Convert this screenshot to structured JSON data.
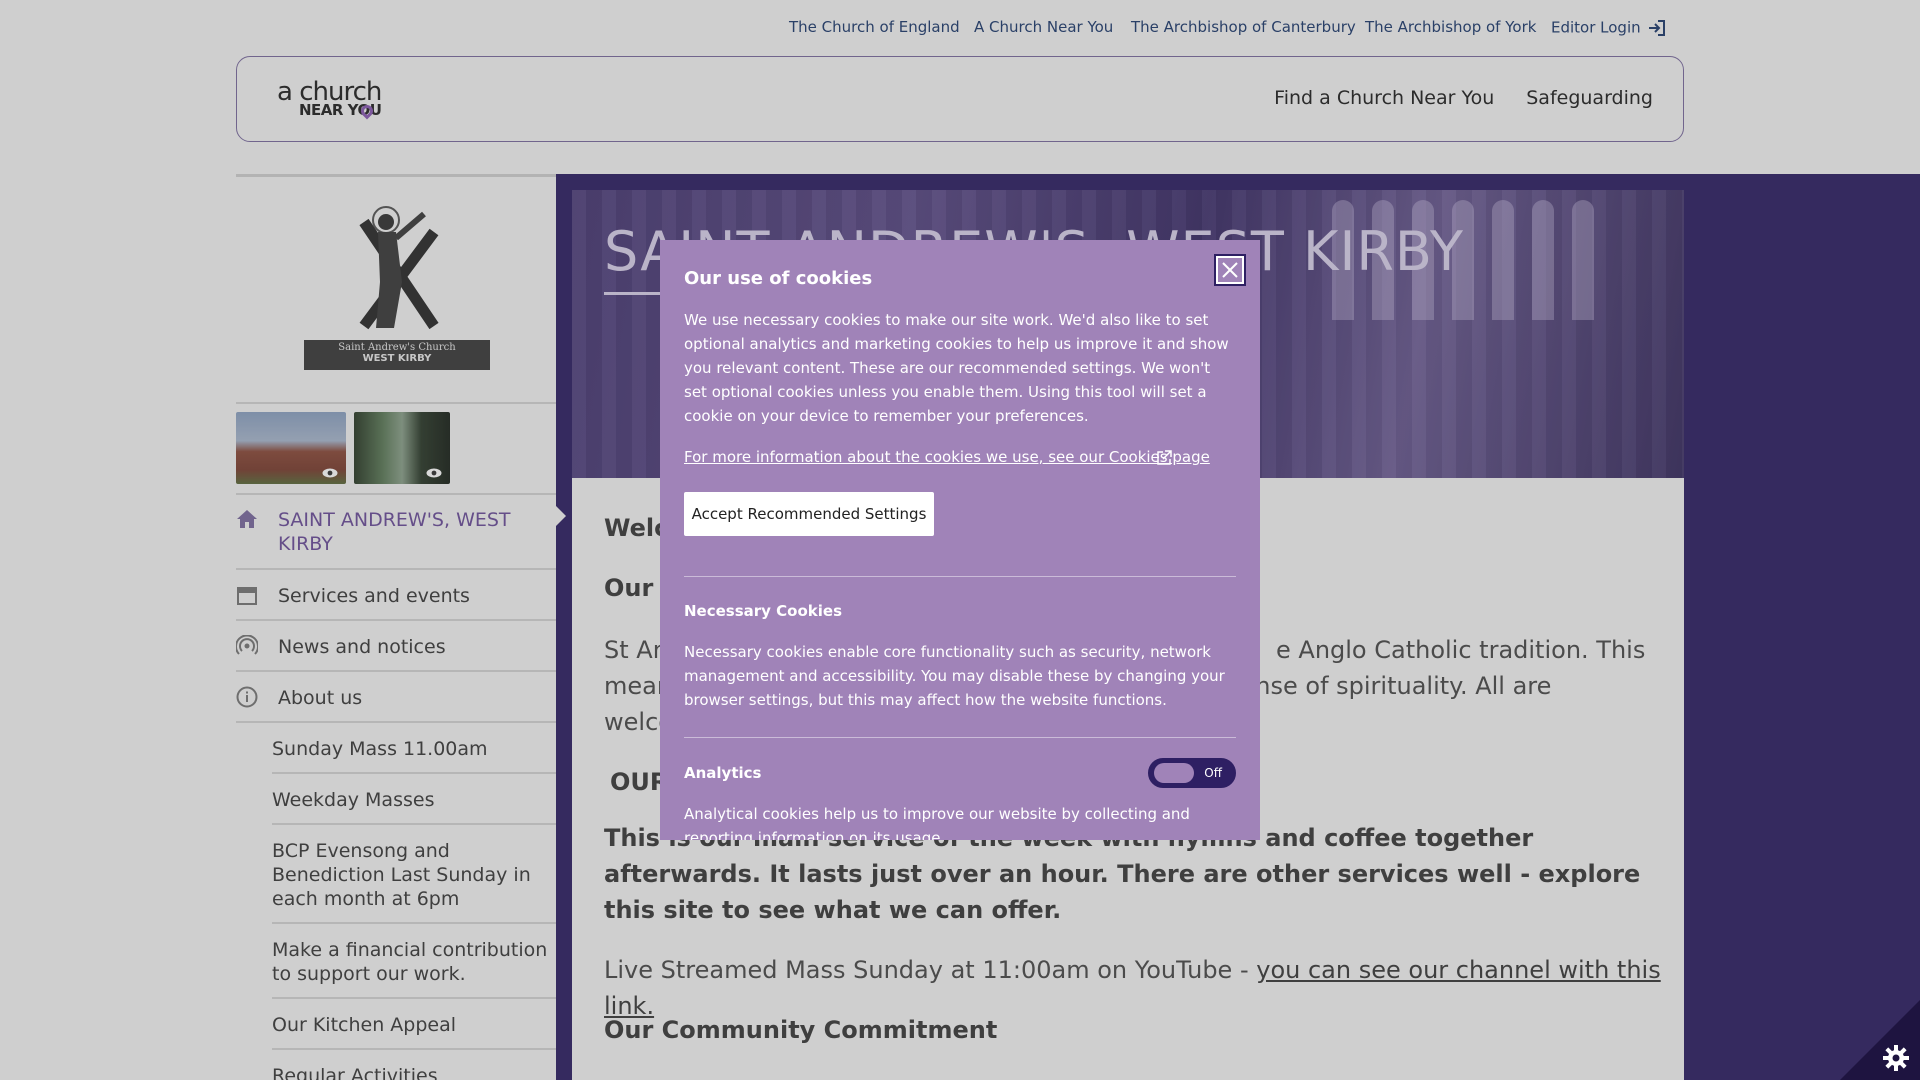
{
  "utility_nav": [
    {
      "label": "The Church of England"
    },
    {
      "label": "A Church Near You"
    },
    {
      "label": "The Archbishop of Canterbury"
    },
    {
      "label": "The Archbishop of York"
    },
    {
      "label": "Editor Login"
    }
  ],
  "logo": {
    "line1": "a church",
    "line2": "NEAR YOU"
  },
  "main_nav": [
    {
      "label": "Find a Church Near You"
    },
    {
      "label": "Safeguarding"
    }
  ],
  "crest": {
    "line1": "Saint Andrew's Church",
    "line2": "WEST KIRBY"
  },
  "sidebar": {
    "items": [
      {
        "label": "SAINT ANDREW'S, WEST KIRBY",
        "icon": "home-icon",
        "active": true
      },
      {
        "label": "Services and events",
        "icon": "calendar-icon"
      },
      {
        "label": "News and notices",
        "icon": "broadcast-icon"
      },
      {
        "label": "About us",
        "icon": "info-icon"
      }
    ],
    "subitems": [
      {
        "label": "Sunday Mass 11.00am"
      },
      {
        "label": "Weekday Masses"
      },
      {
        "label": "BCP Evensong and Benediction Last Sunday in each month at 6pm"
      },
      {
        "label": "Make a financial contribution to support our work."
      },
      {
        "label": "Our Kitchen Appeal"
      },
      {
        "label": "Regular Activities"
      }
    ]
  },
  "hero": {
    "title": "SAINT ANDREW'S, WEST KIRBY"
  },
  "content": {
    "welcome_partial": "Welc",
    "our_partial": "Our S",
    "para1_line1_left": "St An",
    "para1_line1_right": "e Anglo Catholic tradition. This",
    "para1_line2_left": "mean",
    "para1_line2_right": "sense of spirituality. All are",
    "para1_line3_left": "welco",
    "heading2_partial": "OUR",
    "bold_para": "This is our main service of the week with hymns and coffee together afterwards. It lasts just over an hour. There are other services well  - explore this site to see what we can offer.",
    "live_text": "Live Streamed Mass Sunday at 11:00am on YouTube - ",
    "live_link": "you can see our channel with this link.",
    "community_heading": "Our Community Commitment"
  },
  "cookie_modal": {
    "title": "Our use of cookies",
    "intro": "We use necessary cookies to make our site work. We'd also like to set optional analytics and marketing cookies to help us improve it and show you relevant content. These are our recommended settings. We won't set optional cookies unless you enable them. Using this tool will set a cookie on your device to remember your preferences.",
    "more_link": "For more information about the cookies we use, see our Cookies page",
    "accept_label": "Accept Recommended Settings",
    "necessary_title": "Necessary Cookies",
    "necessary_text": "Necessary cookies enable core functionality such as security, network management and accessibility. You may disable these by changing your browser settings, but this may affect how the website functions.",
    "analytics_title": "Analytics",
    "analytics_toggle": "Off",
    "analytics_text": "Analytical cookies help us to improve our website by collecting and reporting information on its usage."
  },
  "colors": {
    "brand_purple": "#2e1f63",
    "modal_purple": "#a083b8",
    "link_blue": "#1f3b6e"
  }
}
